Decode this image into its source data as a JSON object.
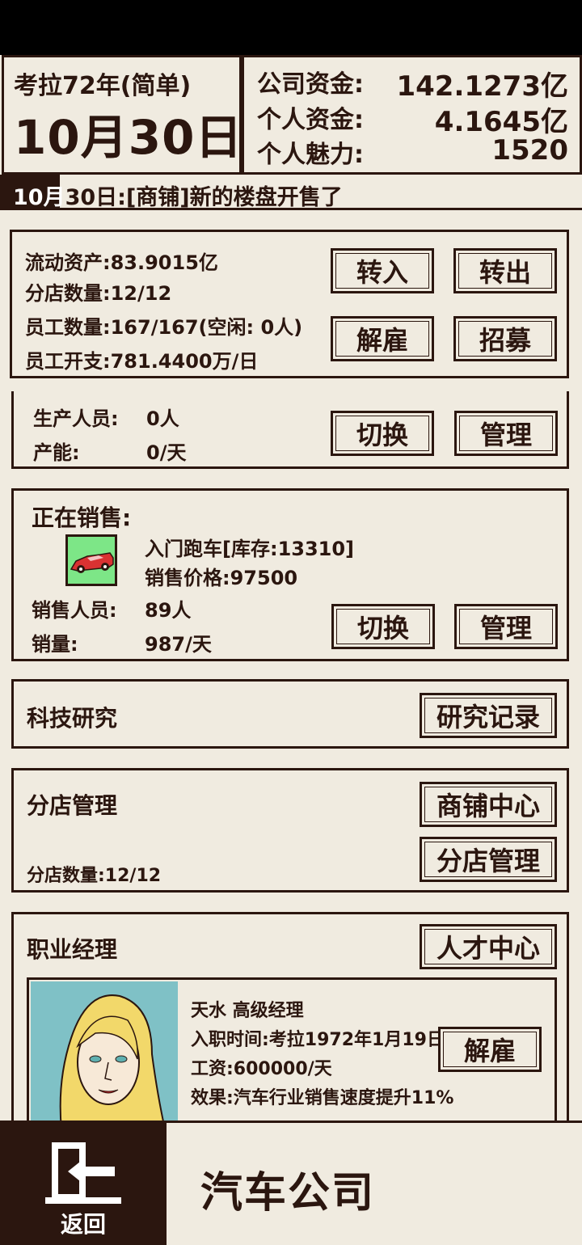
{
  "header": {
    "era": "考拉72年(简单)",
    "date": "10月30日",
    "company_funds_label": "公司资金:",
    "company_funds": "142.1273亿",
    "personal_funds_label": "个人资金:",
    "personal_funds": "4.1645亿",
    "charisma_label": "个人魅力:",
    "charisma": "1520"
  },
  "news": {
    "prefix": "10月",
    "text": "30日:[商铺]新的楼盘开售了"
  },
  "overview": {
    "current_assets": "流动资产:83.9015亿",
    "branches": "分店数量:12/12",
    "employees": "员工数量:167/167(空闲: 0人)",
    "expense": "员工开支:781.4400万/日",
    "transfer_in": "转入",
    "transfer_out": "转出",
    "fire": "解雇",
    "recruit": "招募"
  },
  "production": {
    "staff_label": "生产人员:",
    "staff_value": "0人",
    "capacity_label": "产能:",
    "capacity_value": "0/天",
    "switch": "切换",
    "manage": "管理"
  },
  "sales": {
    "title": "正在销售:",
    "product": "入门跑车[库存:13310]",
    "price": "销售价格:97500",
    "staff_label": "销售人员:",
    "staff_value": "89人",
    "volume_label": "销量:",
    "volume_value": "987/天",
    "switch": "切换",
    "manage": "管理",
    "icon": "sports-car-icon"
  },
  "research": {
    "title": "科技研究",
    "records": "研究记录"
  },
  "branch": {
    "title": "分店管理",
    "count": "分店数量:12/12",
    "shop_center": "商铺中心",
    "branch_manage": "分店管理"
  },
  "manager": {
    "title": "职业经理",
    "talent_center": "人才中心",
    "name": "天水 高级经理",
    "hired": "入职时间:考拉1972年1月19日",
    "salary": "工资:600000/天",
    "effect": "效果:汽车行业销售速度提升11%",
    "fire": "解雇"
  },
  "bottom": {
    "back": "返回",
    "company": "汽车公司"
  },
  "colors": {
    "background": "#f0ebe0",
    "ink": "#2b160f",
    "car_icon_bg": "#7de687",
    "portrait_bg": "#7fc1c6"
  }
}
